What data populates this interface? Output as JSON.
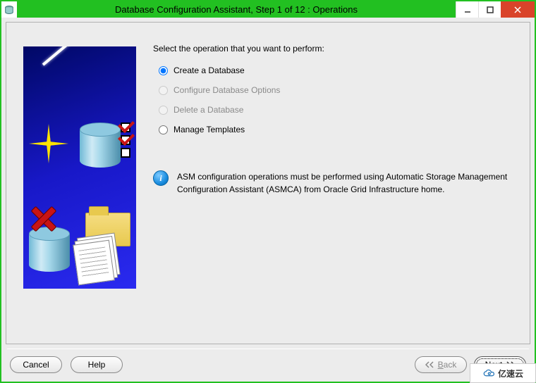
{
  "window": {
    "title": "Database Configuration Assistant, Step 1 of 12 : Operations"
  },
  "main": {
    "prompt": "Select the operation that you want to perform:",
    "options": {
      "create": "Create a Database",
      "configure": "Configure Database Options",
      "delete": "Delete a Database",
      "templates": "Manage Templates"
    },
    "selected_option": "create",
    "disabled_options": [
      "configure",
      "delete"
    ],
    "info": "ASM configuration operations must be performed using Automatic Storage Management Configuration Assistant (ASMCA) from Oracle Grid Infrastructure home."
  },
  "footer": {
    "cancel": "Cancel",
    "help": "Help",
    "back_mn": "B",
    "back_rest": "ack",
    "next_mn": "N",
    "next_rest": "ext"
  },
  "watermark": {
    "text": "亿速云"
  }
}
